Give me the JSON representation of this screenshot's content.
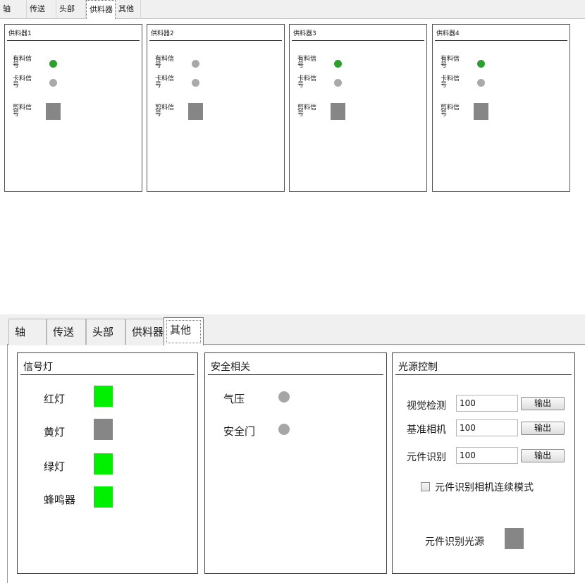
{
  "top": {
    "tabs": [
      {
        "label": "轴",
        "active": false
      },
      {
        "label": "传送",
        "active": false
      },
      {
        "label": "头部",
        "active": false
      },
      {
        "label": "供料器",
        "active": true
      },
      {
        "label": "其他",
        "active": false
      }
    ],
    "feeders": [
      {
        "title": "供料器1",
        "has_label": [
          "有料信",
          "号"
        ],
        "card_label": [
          "卡料信",
          "号"
        ],
        "cut_label": [
          "剪料信",
          "号"
        ],
        "has_color": "#2e9e2e",
        "card_color": "#a9a9a9",
        "cut_color": "#868686"
      },
      {
        "title": "供料器2",
        "has_label": [
          "有料信",
          "号"
        ],
        "card_label": [
          "卡料信",
          "号"
        ],
        "cut_label": [
          "剪料信",
          "号"
        ],
        "has_color": "#a9a9a9",
        "card_color": "#a9a9a9",
        "cut_color": "#868686"
      },
      {
        "title": "供料器3",
        "has_label": [
          "有料信",
          "号"
        ],
        "card_label": [
          "卡料信",
          "号"
        ],
        "cut_label": [
          "剪料信",
          "号"
        ],
        "has_color": "#2e9e2e",
        "card_color": "#a9a9a9",
        "cut_color": "#868686"
      },
      {
        "title": "供料器4",
        "has_label": [
          "有料信",
          "号"
        ],
        "card_label": [
          "卡料信",
          "号"
        ],
        "cut_label": [
          "剪料信",
          "号"
        ],
        "has_color": "#2e9e2e",
        "card_color": "#a9a9a9",
        "cut_color": "#868686"
      }
    ]
  },
  "bottom": {
    "tabs": [
      {
        "label": "轴",
        "active": false
      },
      {
        "label": "传送",
        "active": false
      },
      {
        "label": "头部",
        "active": false
      },
      {
        "label": "供料器",
        "active": false
      },
      {
        "label": "其他",
        "active": true
      }
    ],
    "signal_lights": {
      "title": "信号灯",
      "items": [
        {
          "label": "红灯",
          "color": "#00f000"
        },
        {
          "label": "黄灯",
          "color": "#868686"
        },
        {
          "label": "绿灯",
          "color": "#00f000"
        },
        {
          "label": "蜂鸣器",
          "color": "#00f000"
        }
      ]
    },
    "safety": {
      "title": "安全相关",
      "items": [
        {
          "label": "气压",
          "color": "#a6a6a6"
        },
        {
          "label": "安全门",
          "color": "#a6a6a6"
        }
      ]
    },
    "light_control": {
      "title": "光源控制",
      "rows": [
        {
          "label": "视觉检测",
          "value": "100",
          "button": "输出"
        },
        {
          "label": "基准相机",
          "value": "100",
          "button": "输出"
        },
        {
          "label": "元件识别",
          "value": "100",
          "button": "输出"
        }
      ],
      "continuous_mode_label": "元件识别相机连续模式",
      "continuous_mode_checked": false,
      "source_label": "元件识别光源",
      "source_color": "#868686"
    }
  }
}
